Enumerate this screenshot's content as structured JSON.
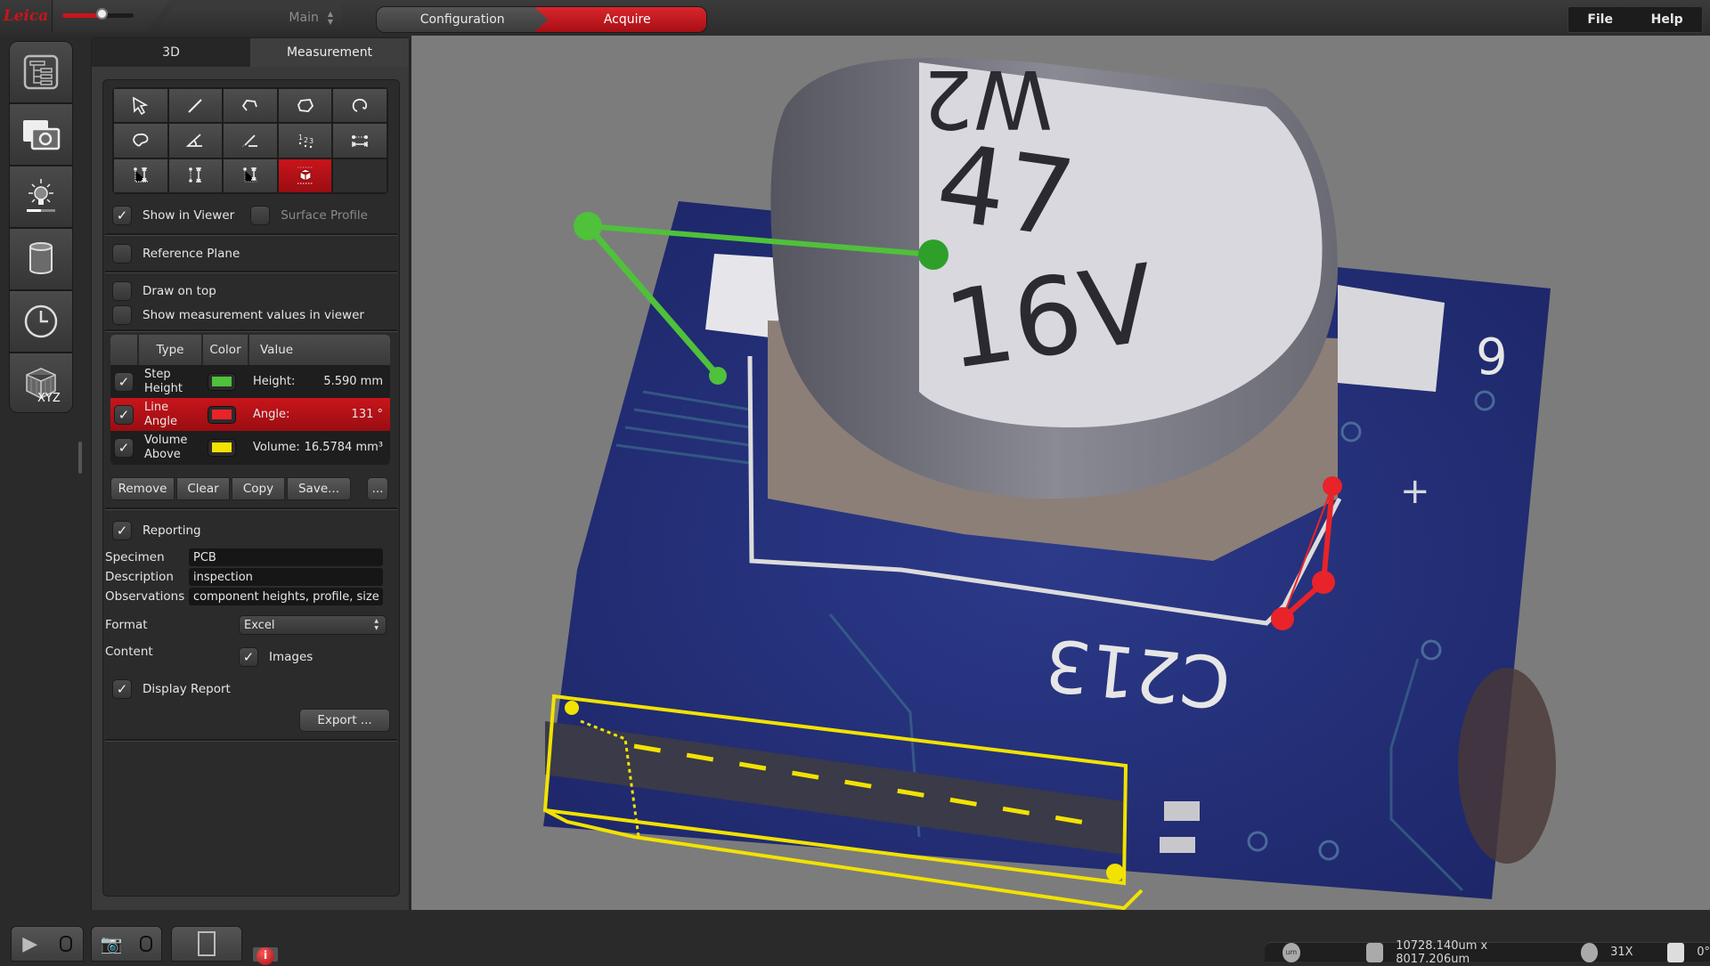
{
  "topbar": {
    "logo": "Leica",
    "zoom_slider_value": 0.55,
    "workspace_select": "Main",
    "workflow": {
      "configuration": "Configuration",
      "acquire": "Acquire",
      "active": "Acquire"
    },
    "menu": {
      "file": "File",
      "help": "Help"
    }
  },
  "rail": {
    "items": [
      {
        "icon": "tree-structure-icon"
      },
      {
        "icon": "camera-image-icon"
      },
      {
        "icon": "illumination-bulb-icon"
      },
      {
        "icon": "cylinder-icon"
      },
      {
        "icon": "clock-icon"
      },
      {
        "icon": "xyz-cube-icon",
        "label": "XYZ"
      }
    ]
  },
  "panel": {
    "tabs": [
      {
        "label": "3D"
      },
      {
        "label": "Measurement",
        "active": true
      }
    ],
    "tools": [
      "pointer-icon",
      "line-icon",
      "polyline-icon",
      "polygon-icon",
      "freehand-open-icon",
      "freehand-closed-icon",
      "angle-icon",
      "line-angle-icon",
      "point-count-icon",
      "distance-icon",
      "step-height-icon",
      "height-difference-icon",
      "volume-height-icon",
      "volume-above-icon"
    ],
    "active_tool": "volume-above-icon",
    "options": {
      "show_in_viewer": {
        "label": "Show in Viewer",
        "checked": true
      },
      "surface_profile": {
        "label": "Surface Profile",
        "checked": false
      },
      "reference_plane": {
        "label": "Reference Plane",
        "checked": false
      },
      "draw_on_top": {
        "label": "Draw on top",
        "checked": false
      },
      "show_values": {
        "label": "Show measurement values in viewer",
        "checked": false
      }
    },
    "table": {
      "headers": {
        "type": "Type",
        "color": "Color",
        "value": "Value"
      },
      "rows": [
        {
          "checked": true,
          "type_line1": "Step",
          "type_line2": "Height",
          "color": "#4fc13a",
          "label": "Height:",
          "value": "5.590 mm",
          "selected": false
        },
        {
          "checked": true,
          "type_line1": "Line",
          "type_line2": "Angle",
          "color": "#e8232a",
          "label": "Angle:",
          "value": "131 °",
          "selected": true
        },
        {
          "checked": true,
          "type_line1": "Volume",
          "type_line2": "Above",
          "color": "#f2e200",
          "label": "Volume:",
          "value": "16.5784 mm³",
          "selected": false
        }
      ]
    },
    "actions": {
      "remove": "Remove",
      "clear": "Clear",
      "copy": "Copy",
      "save": "Save...",
      "more": "..."
    },
    "reporting": {
      "enabled": {
        "label": "Reporting",
        "checked": true
      },
      "specimen": {
        "label": "Specimen",
        "value": "PCB"
      },
      "description": {
        "label": "Description",
        "value": "inspection"
      },
      "observations": {
        "label": "Observations",
        "value": "component heights, profile, size"
      },
      "format": {
        "label": "Format",
        "value": "Excel"
      },
      "content": {
        "label": "Content",
        "images": {
          "label": "Images",
          "checked": true
        }
      },
      "display_report": {
        "label": "Display Report",
        "checked": true
      },
      "export": "Export ..."
    }
  },
  "viewer": {
    "specimen_text": {
      "cap_line1": "W2",
      "cap_line2": "47",
      "cap_line3": "16V",
      "silkscreen": "C213",
      "pin": "9"
    },
    "overlay_colors": {
      "step_height": "#4fc13a",
      "line_angle": "#e8232a",
      "volume": "#f2e200"
    }
  },
  "statusbar": {
    "unit_icon": "um",
    "field_of_view": "10728.140um x 8017.206um",
    "magnification": "31X",
    "rotation": "0°"
  }
}
